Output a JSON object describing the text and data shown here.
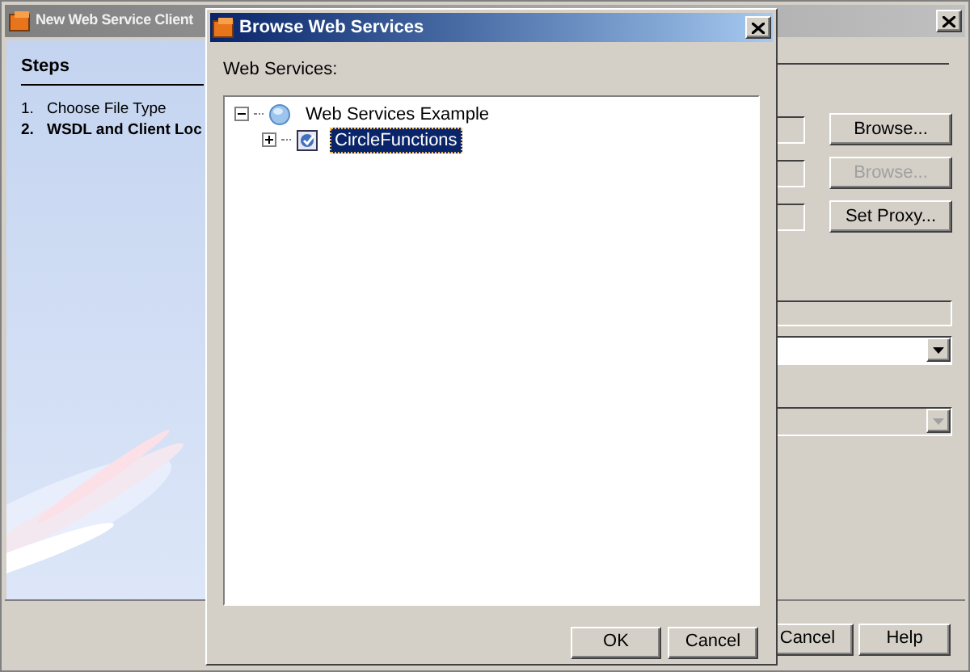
{
  "window": {
    "title": "New Web Service Client"
  },
  "steps": {
    "heading": "Steps",
    "items": [
      {
        "number": "1.",
        "label": "Choose File Type",
        "selected": false
      },
      {
        "number": "2.",
        "label": "WSDL and Client Loc",
        "selected": true
      }
    ]
  },
  "side_buttons": [
    {
      "label": "Browse...",
      "disabled": false
    },
    {
      "label": "Browse...",
      "disabled": true
    },
    {
      "label": "Set Proxy...",
      "disabled": false
    }
  ],
  "combos": [
    {
      "disabled": false
    },
    {
      "disabled": true
    }
  ],
  "footer_buttons": [
    "Cancel",
    "Help"
  ],
  "dialog": {
    "title": "Browse Web Services",
    "label": "Web Services:",
    "tree": [
      {
        "label": "Web Services Example",
        "expanded": true,
        "selected": false,
        "children": [
          {
            "label": "CircleFunctions",
            "expanded": false,
            "selected": true
          }
        ]
      }
    ],
    "buttons": [
      "OK",
      "Cancel"
    ]
  }
}
